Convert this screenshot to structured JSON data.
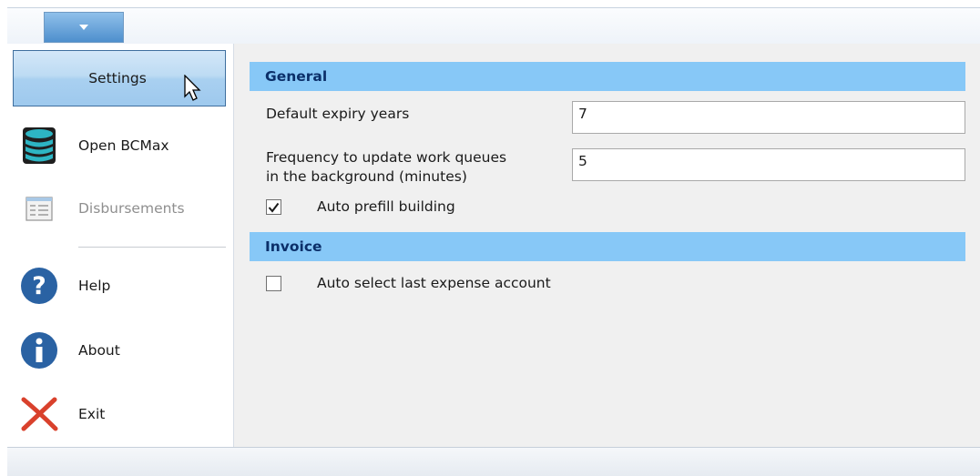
{
  "left_panel": {
    "settings_label": "Settings",
    "items": [
      {
        "label": "Open BCMax",
        "icon": "database-icon",
        "disabled": false
      },
      {
        "label": "Disbursements",
        "icon": "list-document-icon",
        "disabled": true
      },
      {
        "label": "Help",
        "icon": "question-icon",
        "disabled": false
      },
      {
        "label": "About",
        "icon": "info-icon",
        "disabled": false
      },
      {
        "label": "Exit",
        "icon": "close-x-icon",
        "disabled": false
      }
    ]
  },
  "general": {
    "title": "General",
    "expiry_label": "Default expiry years",
    "expiry_value": "7",
    "frequency_label_1": "Frequency to update work queues",
    "frequency_label_2": "in the background (minutes)",
    "frequency_value": "5",
    "auto_prefill_label": "Auto prefill building",
    "auto_prefill_checked": true
  },
  "invoice": {
    "title": "Invoice",
    "auto_select_label": "Auto select last expense account",
    "auto_select_checked": false
  },
  "colors": {
    "section_header_bg": "#87c8f7",
    "section_header_text": "#0b2f69",
    "settings_button": "#a9d0f0",
    "menu_button": "#4e8fcd"
  }
}
